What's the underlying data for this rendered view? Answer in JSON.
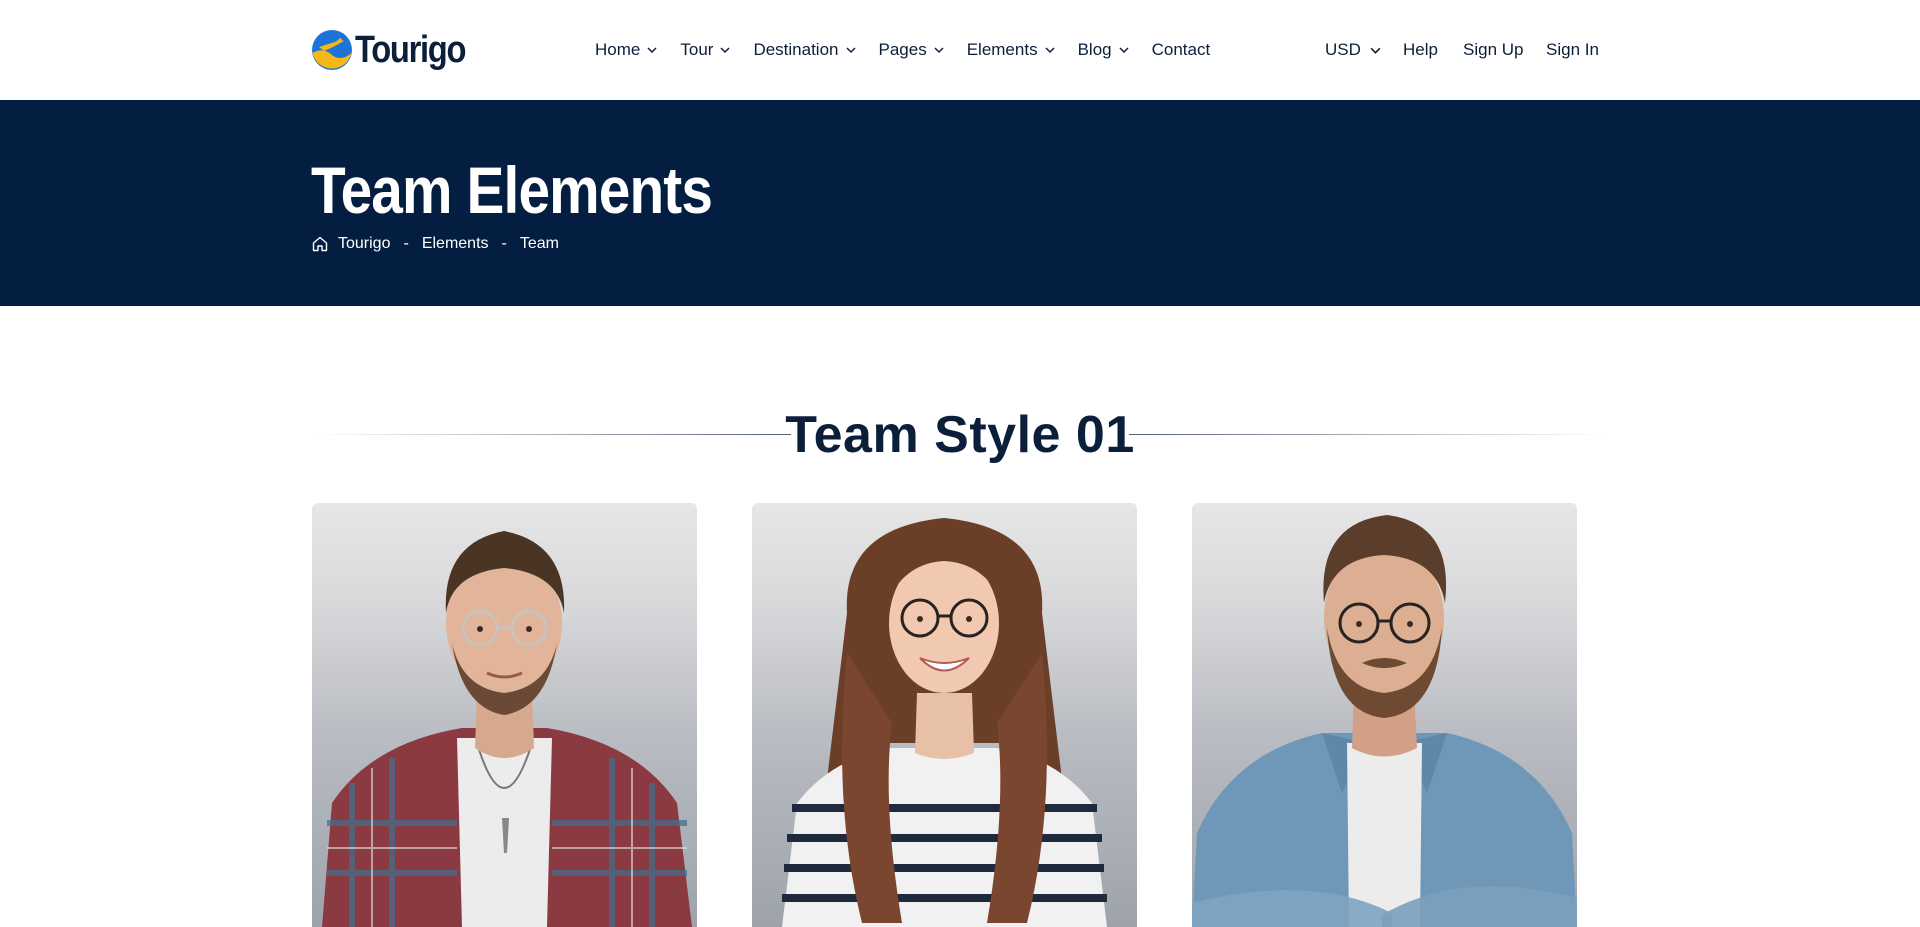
{
  "header": {
    "logo_text": "Tourigo",
    "logo_icon": "plane-sun-logo-icon",
    "nav": [
      {
        "label": "Home",
        "has_dropdown": true
      },
      {
        "label": "Tour",
        "has_dropdown": true
      },
      {
        "label": "Destination",
        "has_dropdown": true
      },
      {
        "label": "Pages",
        "has_dropdown": true
      },
      {
        "label": "Elements",
        "has_dropdown": true
      },
      {
        "label": "Blog",
        "has_dropdown": true
      },
      {
        "label": "Contact",
        "has_dropdown": false
      }
    ],
    "currency": "USD",
    "help": "Help",
    "sign_up": "Sign Up",
    "sign_in": "Sign In"
  },
  "hero": {
    "title": "Team Elements",
    "breadcrumb": [
      "Tourigo",
      "Elements",
      "Team"
    ],
    "separator": "-"
  },
  "section": {
    "title": "Team Style 01"
  },
  "team_cards": [
    {
      "photo": "man-plaid-shirt-glasses"
    },
    {
      "photo": "woman-striped-shirt-glasses"
    },
    {
      "photo": "man-denim-shirt-glasses"
    }
  ],
  "colors": {
    "navy": "#041e42",
    "text": "#0b1f3a",
    "logo_blue": "#1e73d8",
    "logo_yellow": "#f7b718"
  }
}
